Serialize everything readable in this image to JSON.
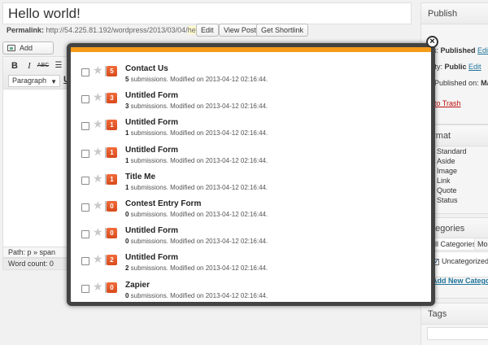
{
  "editor": {
    "title": "Hello world!",
    "permalink_label": "Permalink:",
    "permalink_base": "http://54.225.81.192/wordpress/2013/03/04/",
    "permalink_slug": "hello-world",
    "permalink_tail": "/",
    "edit_label": "Edit",
    "view_post_label": "View Post",
    "shortlink_label": "Get Shortlink",
    "add_media_label": "Add Media",
    "paragraph_label": "Paragraph",
    "path_label": "Path: p » span",
    "word_count_label": "Word count: 0",
    "toolbar": {
      "bold": "B",
      "italic": "I",
      "strike": "ABC",
      "underline": "U"
    }
  },
  "sidebar": {
    "publish_title": "Publish",
    "status_text": "tatus: ",
    "status_value": "Published",
    "status_edit": "Edit",
    "visibility_text": "sibility: ",
    "visibility_value": "Public",
    "visibility_edit": "Edit",
    "published_on_text": "Published on: ",
    "published_on_value": "Mar",
    "trash_label": "ove to Trash",
    "format_title": "ormat",
    "formats": [
      "Standard",
      "Aside",
      "Image",
      "Link",
      "Quote",
      "Status"
    ],
    "categories_title": "ategories",
    "cat_tab_all": "All Categories",
    "cat_tab_most": "Mos",
    "category_item": "Uncategorized",
    "add_category_label": "Add New Category",
    "tags_title": "Tags"
  },
  "modal": {
    "accent_color": "#f59b1a",
    "meta_suffix": " submissions. Modified on ",
    "forms": [
      {
        "name": "Contact Us",
        "count": "5",
        "submissions": "5",
        "modified": "2013-04-12 02:16:44."
      },
      {
        "name": "Untitled Form",
        "count": "3",
        "submissions": "3",
        "modified": "2013-04-12 02:16:44."
      },
      {
        "name": "Untitled Form",
        "count": "1",
        "submissions": "1",
        "modified": "2013-04-12 02:16:44."
      },
      {
        "name": "Untitled Form",
        "count": "1",
        "submissions": "1",
        "modified": "2013-04-12 02:16:44."
      },
      {
        "name": "Title Me",
        "count": "1",
        "submissions": "1",
        "modified": "2013-04-12 02:16:44."
      },
      {
        "name": "Contest Entry Form",
        "count": "0",
        "submissions": "0",
        "modified": "2013-04-12 02:16:44."
      },
      {
        "name": "Untitled Form",
        "count": "0",
        "submissions": "0",
        "modified": "2013-04-12 02:16:44."
      },
      {
        "name": "Untitled Form",
        "count": "2",
        "submissions": "2",
        "modified": "2013-04-12 02:16:44."
      },
      {
        "name": "Zapier",
        "count": "0",
        "submissions": "0",
        "modified": "2013-04-12 02:16:44."
      }
    ]
  }
}
